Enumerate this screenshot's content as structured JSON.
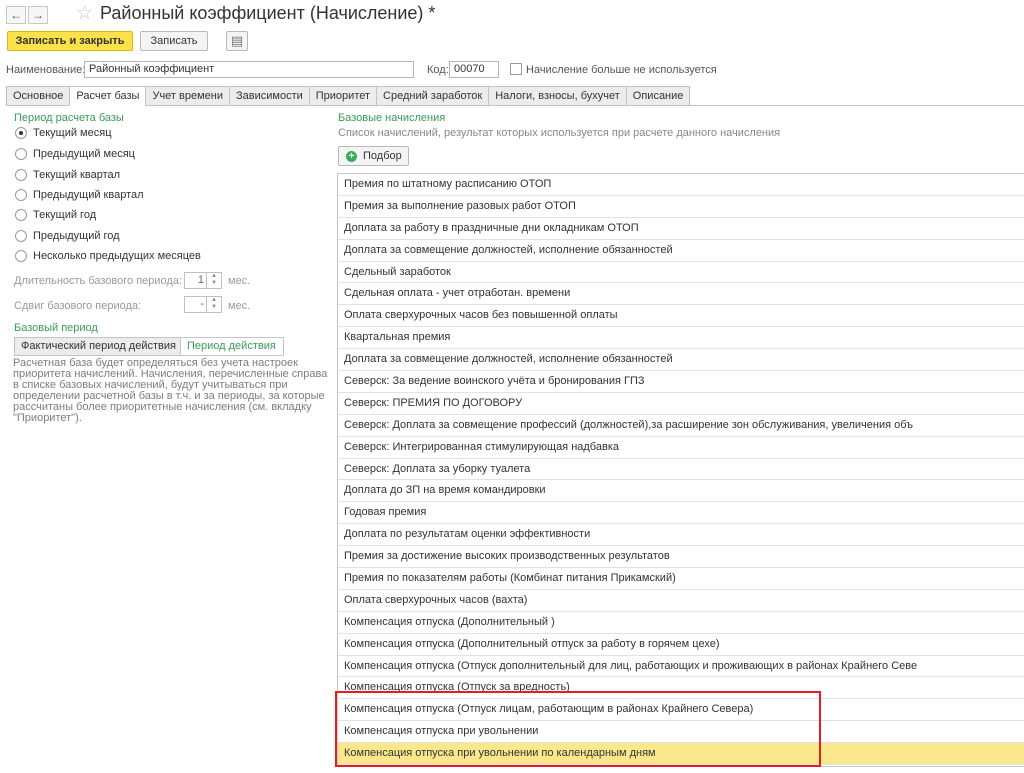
{
  "window": {
    "title": "Районный коэффициент (Начисление) *",
    "back_icon": "←",
    "forward_icon": "→",
    "favorite_icon": "☆"
  },
  "toolbar": {
    "save_close_label": "Записать и закрыть",
    "save_label": "Записать",
    "report_icon": "▤"
  },
  "header": {
    "name_label": "Наименование:",
    "name_value": "Районный коэффициент",
    "code_label": "Код:",
    "code_value": "00070",
    "unused_label": "Начисление больше не используется"
  },
  "tabs": [
    {
      "label": "Основное"
    },
    {
      "label": "Расчет базы"
    },
    {
      "label": "Учет времени"
    },
    {
      "label": "Зависимости"
    },
    {
      "label": "Приоритет"
    },
    {
      "label": "Средний заработок"
    },
    {
      "label": "Налоги, взносы, бухучет"
    },
    {
      "label": "Описание"
    }
  ],
  "period": {
    "title": "Период расчета базы",
    "options": [
      {
        "label": "Текущий месяц"
      },
      {
        "label": "Предыдущий месяц"
      },
      {
        "label": "Текущий квартал"
      },
      {
        "label": "Предыдущий квартал"
      },
      {
        "label": "Текущий год"
      },
      {
        "label": "Предыдущий год"
      },
      {
        "label": "Несколько предыдущих месяцев"
      }
    ],
    "duration_label": "Длительность базового периода:",
    "duration_value": "1",
    "duration_unit": "мес.",
    "shift_label": "Сдвиг базового периода:",
    "shift_value": "-",
    "shift_unit": "мес."
  },
  "base_period": {
    "title": "Базовый период",
    "actual_label": "Фактический период действия",
    "period_label": "Период действия",
    "note": "Расчетная база будет определяться без учета настроек приоритета начислений. Начисления, перечисленные справа в списке базовых начислений, будут учитываться при определении расчетной базы в т.ч. и за периоды, за которые рассчитаны более приоритетные начисления (см. вкладку \"Приоритет\")."
  },
  "base_accruals": {
    "title": "Базовые начисления",
    "subtitle": "Список начислений, результат которых используется при расчете данного начисления",
    "select_label": "Подбор",
    "items": [
      "Премия по штатному расписанию ОТОП",
      "Премия за выполнение разовых работ ОТОП",
      "Доплата за работу в праздничные дни окладникам ОТОП",
      "Доплата за совмещение должностей, исполнение обязанностей",
      "Сдельный заработок",
      "Сдельная оплата - учет отработан. времени",
      "Оплата сверхурочных часов без повышенной оплаты",
      "Квартальная премия",
      "Доплата за совмещение должностей, исполнение обязанностей",
      "Северск: За ведение воинского учёта и бронирования ГПЗ",
      "Северск: ПРЕМИЯ ПО ДОГОВОРУ",
      "Северск: Доплата за совмещение профессий (должностей),за расширение зон обслуживания, увеличения объ",
      "Северск: Интегрированная стимулирующая надбавка",
      "Северск: Доплата за уборку туалета",
      "Доплата до ЗП на время командировки",
      "Годовая премия",
      "Доплата по результатам оценки эффективности",
      "Премия за достижение высоких производственных результатов",
      "Премия по показателям работы (Комбинат питания Прикамский)",
      " Оплата сверхурочных часов (вахта)",
      "Компенсация отпуска (Дополнительный )",
      "Компенсация отпуска (Дополнительный отпуск за работу в горячем цехе)",
      "Компенсация отпуска (Отпуск дополнительный для лиц, работающих и проживающих в районах Крайнего Севе",
      "Компенсация отпуска (Отпуск за вредность)",
      "Компенсация отпуска (Отпуск лицам, работающим в районах Крайнего Севера)",
      "Компенсация отпуска при увольнении",
      "Компенсация отпуска при увольнении по календарным дням"
    ],
    "selected_index": 26
  },
  "colors": {
    "accent_green": "#3a9b5a",
    "primary_button": "#fbe14a",
    "selected_row": "#fbe88c",
    "highlight_frame": "#e31e24"
  }
}
